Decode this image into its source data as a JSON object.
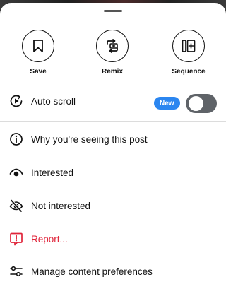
{
  "actions": {
    "save_label": "Save",
    "remix_label": "Remix",
    "sequence_label": "Sequence"
  },
  "menu": {
    "auto_scroll": {
      "label": "Auto scroll",
      "badge": "New",
      "toggle_on": false
    },
    "why_seeing": "Why you're seeing this post",
    "interested": "Interested",
    "not_interested": "Not interested",
    "report": "Report...",
    "manage_prefs": "Manage content preferences"
  },
  "colors": {
    "danger": "#e0243a",
    "badge": "#2b86f0",
    "toggle_off": "#5f6368"
  },
  "icons": {
    "save": "bookmark-icon",
    "remix": "remix-icon",
    "sequence": "sequence-icon",
    "auto_scroll": "play-circle-icon",
    "why_seeing": "info-icon",
    "interested": "eye-icon",
    "not_interested": "eye-off-icon",
    "report": "report-icon",
    "manage_prefs": "sliders-icon"
  }
}
